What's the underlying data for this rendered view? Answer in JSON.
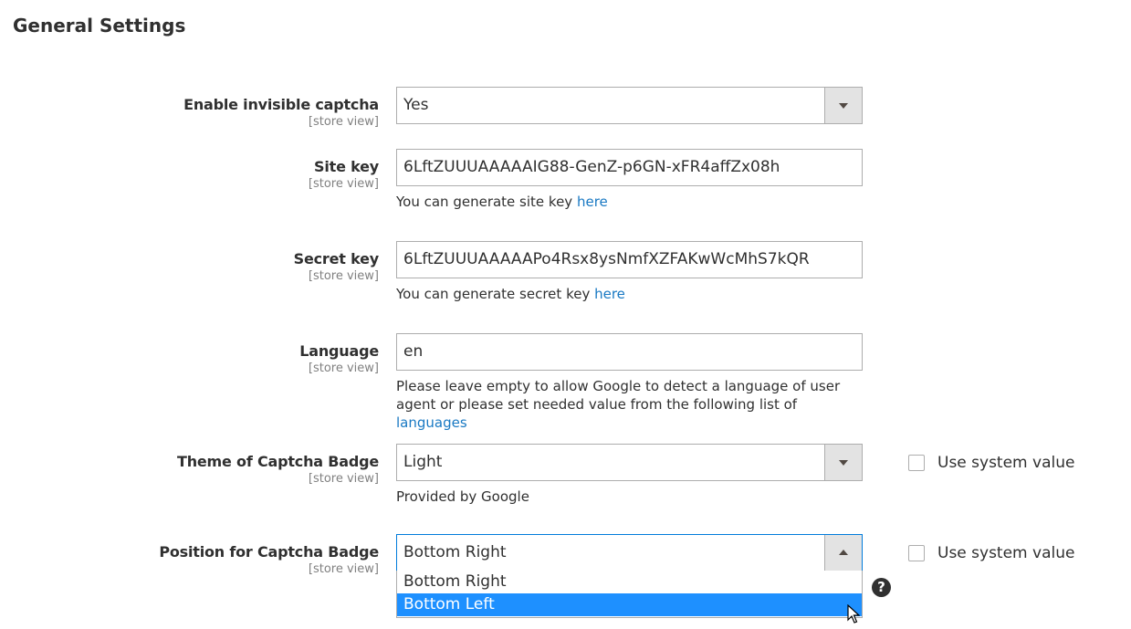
{
  "section": {
    "title": "General Settings"
  },
  "scope_label": "[store view]",
  "fields": {
    "enable": {
      "label": "Enable invisible captcha",
      "value": "Yes"
    },
    "site_key": {
      "label": "Site key",
      "value": "6LftZUUUAAAAAIG88-GenZ-p6GN-xFR4affZx08h",
      "note_text": "You can generate site key",
      "note_link": "here"
    },
    "secret_key": {
      "label": "Secret key",
      "value": "6LftZUUUAAAAAPo4Rsx8ysNmfXZFAKwWcMhS7kQR",
      "note_text": "You can generate secret key",
      "note_link": "here"
    },
    "language": {
      "label": "Language",
      "value": "en",
      "note_text": "Please leave empty to allow Google to detect a language of user agent or please set needed value from the following list of",
      "note_link": "languages"
    },
    "theme": {
      "label": "Theme of Captcha Badge",
      "value": "Light",
      "note_text": "Provided by Google",
      "use_system": "Use system value"
    },
    "position": {
      "label": "Position for Captcha Badge",
      "value": "Bottom Right",
      "use_system": "Use system value",
      "options": [
        "Bottom Right",
        "Bottom Left"
      ],
      "highlighted_option": "Bottom Left"
    }
  },
  "colors": {
    "accent": "#1e90ff",
    "link": "#1979c3",
    "focus": "#007bdb"
  },
  "icons": {
    "help": "question-mark-icon",
    "cursor": "mouse-pointer-icon"
  }
}
